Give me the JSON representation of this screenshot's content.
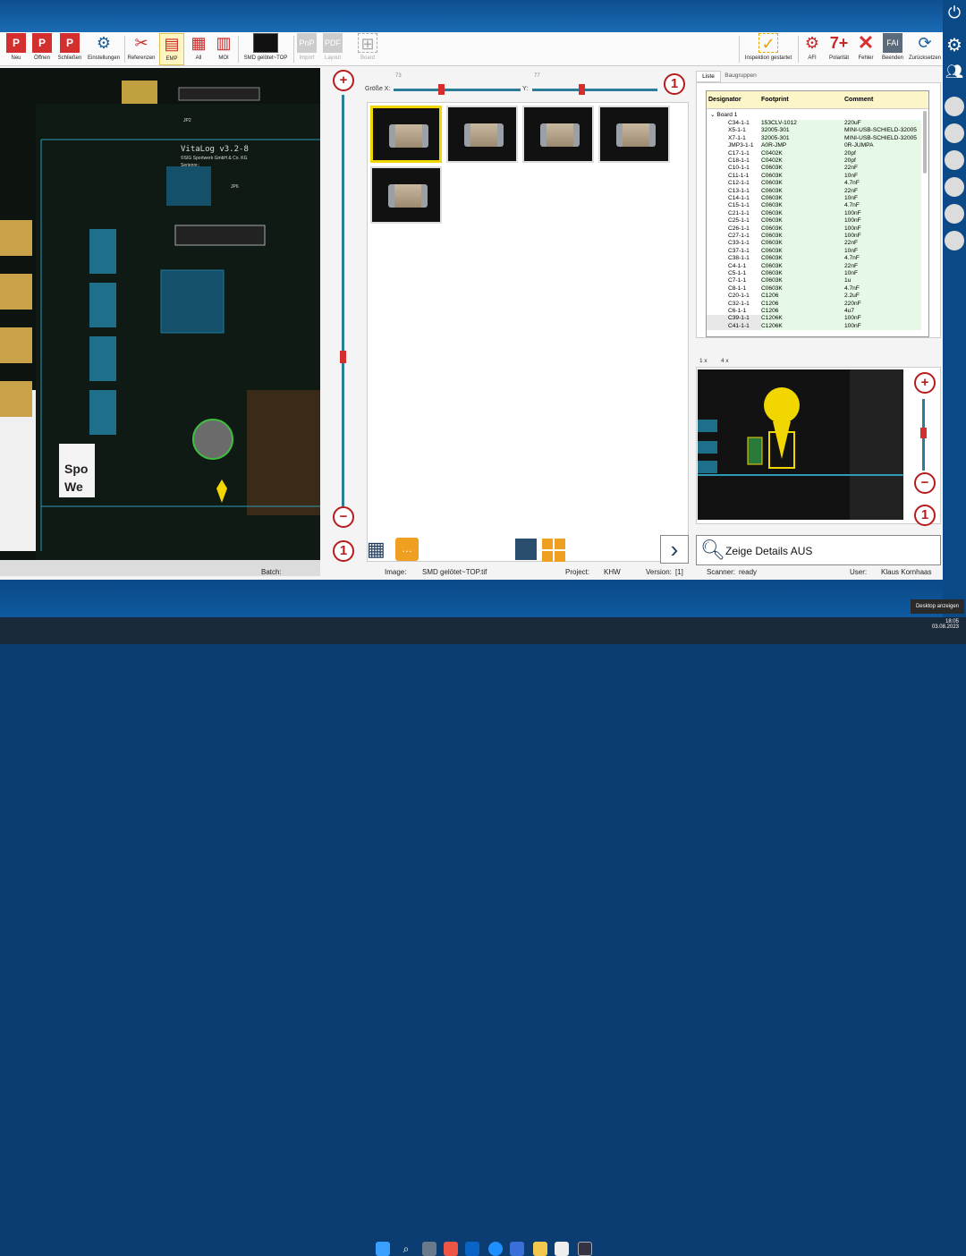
{
  "toolbar": {
    "items": [
      {
        "label": "Neu",
        "icon": "new-project-icon"
      },
      {
        "label": "Öffnen",
        "icon": "open-icon"
      },
      {
        "label": "Schließen",
        "icon": "close-project-icon"
      },
      {
        "label": "Einstellungen",
        "icon": "settings-gear-icon"
      },
      {
        "label": "Referenzen",
        "icon": "references-icon"
      },
      {
        "label": "EMP",
        "icon": "emp-icon"
      },
      {
        "label": "All",
        "icon": "all-icon"
      },
      {
        "label": "MOI",
        "icon": "moi-icon"
      },
      {
        "label": "SMD gelötet~TOP",
        "icon": "board-thumbnail-icon"
      },
      {
        "label": "Import",
        "icon": "import-icon"
      },
      {
        "label": "Layout",
        "icon": "pdf-layout-icon"
      },
      {
        "label": "Board",
        "icon": "board-icon"
      },
      {
        "label": "Inspektion gestartet",
        "icon": "inspection-check-icon"
      },
      {
        "label": "AFI",
        "icon": "afi-icon"
      },
      {
        "label": "Polarität",
        "icon": "polarity-icon"
      },
      {
        "label": "Fehler",
        "icon": "error-x-icon"
      },
      {
        "label": "Beenden",
        "icon": "exit-fai-icon"
      },
      {
        "label": "Zurücksetzen",
        "icon": "reset-icon"
      }
    ]
  },
  "size": {
    "x_label": "Größe X:",
    "y_label": "Y:",
    "x_value": "73",
    "y_value": "77",
    "reset": "1"
  },
  "pcb": {
    "title": "VitaLog v3.2-8",
    "sub1": "©SIG Sportwerk GmbH & Co. KG",
    "sub2": "Seriennr.:",
    "jp2": "JP2",
    "jp6": "JP6",
    "brand": "Spo",
    "brand2": "We",
    "zoom_reset": "1"
  },
  "tabs": {
    "list": "Liste",
    "groups": "Baugruppen",
    "z1": "1 x",
    "z4": "4 x"
  },
  "list": {
    "headers": [
      "Designator",
      "Footprint",
      "Comment"
    ],
    "group": "Board 1",
    "rows": [
      [
        "C34-1-1",
        "153CLV-1012",
        "220uF"
      ],
      [
        "X5-1-1",
        "32005-301",
        "MINI-USB-SCHIELD-32005"
      ],
      [
        "X7-1-1",
        "32005-301",
        "MINI-USB-SCHIELD-32005"
      ],
      [
        "JMP3-1-1",
        "A0R-JMP",
        "0R-JUMPA"
      ],
      [
        "C17-1-1",
        "C0402K",
        "20pf"
      ],
      [
        "C18-1-1",
        "C0402K",
        "20pf"
      ],
      [
        "C10-1-1",
        "C0603K",
        "22nF"
      ],
      [
        "C11-1-1",
        "C0603K",
        "10nF"
      ],
      [
        "C12-1-1",
        "C0603K",
        "4.7nF"
      ],
      [
        "C13-1-1",
        "C0603K",
        "22nF"
      ],
      [
        "C14-1-1",
        "C0603K",
        "10nF"
      ],
      [
        "C15-1-1",
        "C0603K",
        "4.7nF"
      ],
      [
        "C21-1-1",
        "C0603K",
        "100nF"
      ],
      [
        "C25-1-1",
        "C0603K",
        "100nF"
      ],
      [
        "C26-1-1",
        "C0603K",
        "100nF"
      ],
      [
        "C27-1-1",
        "C0603K",
        "100nF"
      ],
      [
        "C33-1-1",
        "C0603K",
        "22nF"
      ],
      [
        "C37-1-1",
        "C0603K",
        "10nF"
      ],
      [
        "C38-1-1",
        "C0603K",
        "4.7nF"
      ],
      [
        "C4-1-1",
        "C0603K",
        "22nF"
      ],
      [
        "C5-1-1",
        "C0603K",
        "10nF"
      ],
      [
        "C7-1-1",
        "C0603K",
        "1u"
      ],
      [
        "C8-1-1",
        "C0603K",
        "4.7nF"
      ],
      [
        "C20-1-1",
        "C1206",
        "2.2uF"
      ],
      [
        "C32-1-1",
        "C1206",
        "220nF"
      ],
      [
        "C6-1-1",
        "C1206",
        "4u7"
      ],
      [
        "C39-1-1",
        "C1206K",
        "100nF"
      ],
      [
        "C41-1-1",
        "C1206K",
        "100nF"
      ]
    ]
  },
  "detail_button": "Zeige Details AUS",
  "status": {
    "batch": "Batch:",
    "image_label": "Image:",
    "image": "SMD gelötet~TOP.tif",
    "project_label": "Project:",
    "project": "KHW",
    "version_label": "Version:",
    "version": "[1]",
    "scanner_label": "Scanner:",
    "scanner": "ready",
    "user_label": "User:",
    "user": "Klaus Kornhaas"
  },
  "tooltip": "Desktop anzeigen",
  "clock": {
    "time": "18:05",
    "date": "03.08.2023"
  },
  "colors": {
    "accent": "#b71c1c",
    "highlight": "#f2d600",
    "teal": "#2d9ab8"
  }
}
